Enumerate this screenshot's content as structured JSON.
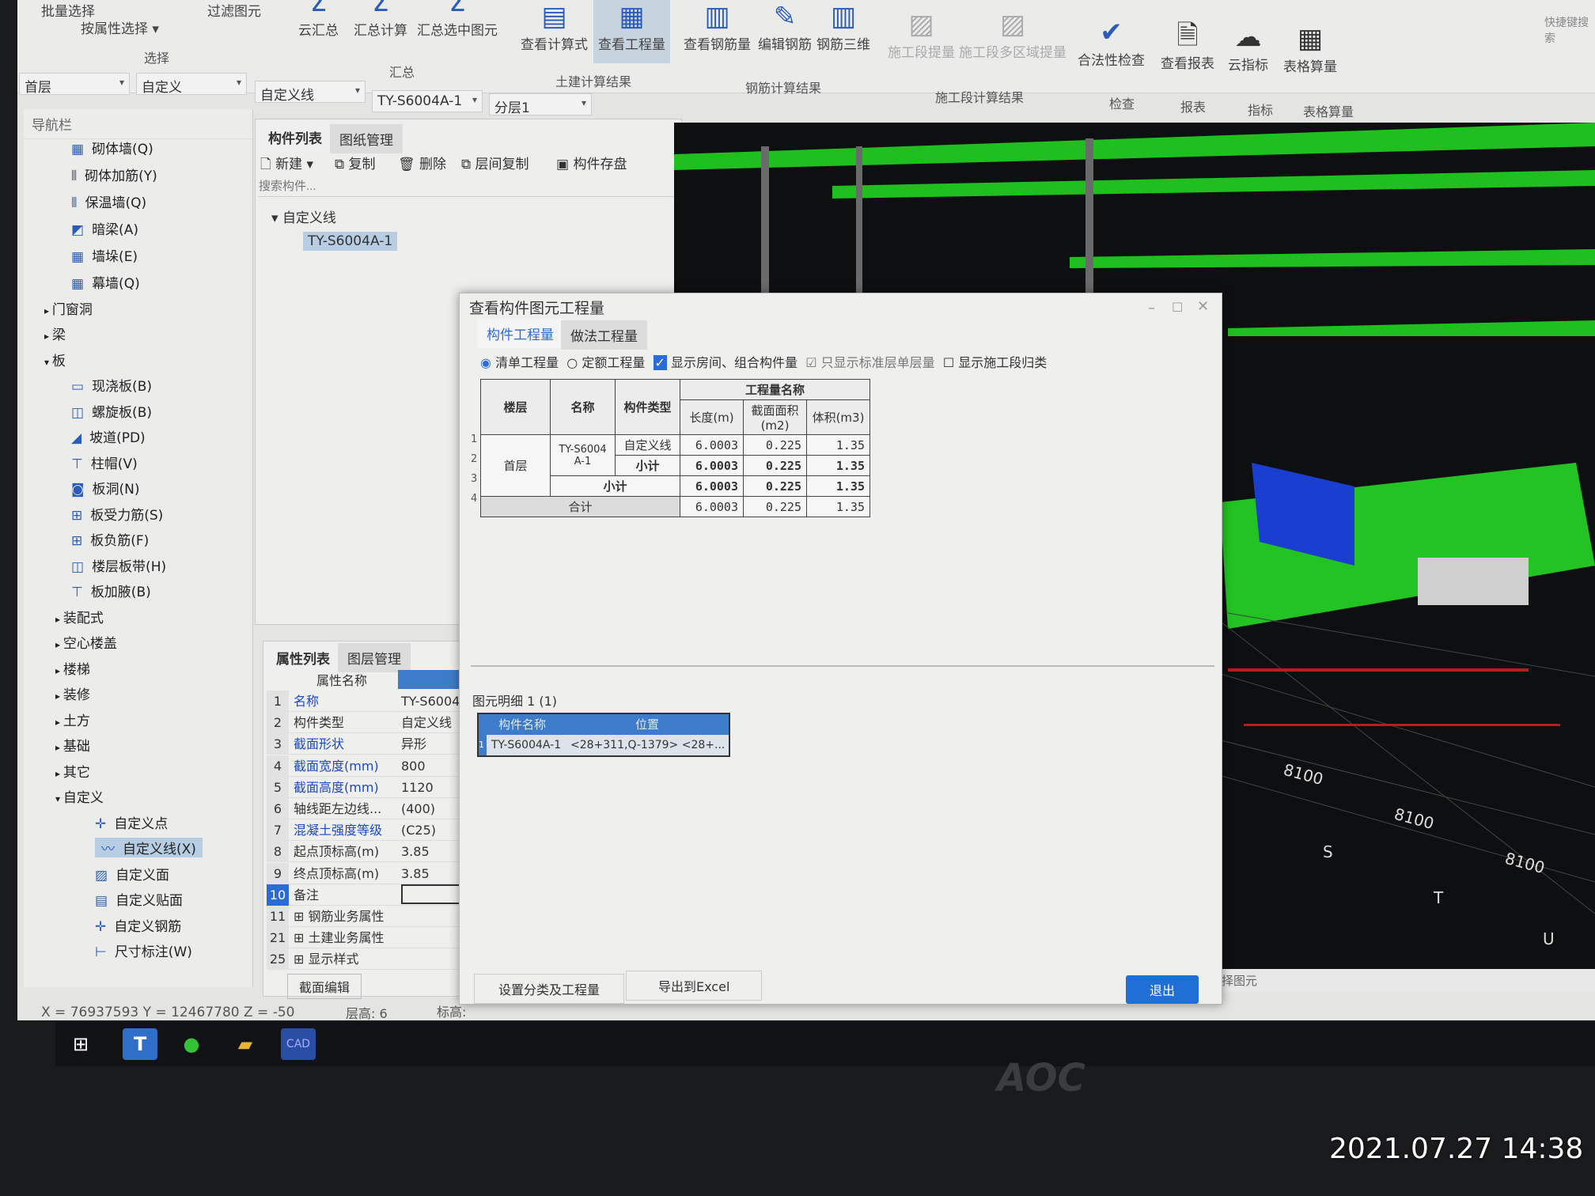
{
  "ribbon": {
    "select_group": "选择",
    "batch_select": "批量选择",
    "filter": "过滤图元",
    "by_attr": "按属性选择",
    "sum_group": "汇总",
    "cloud_sum": "云汇总",
    "sum_calc": "汇总计算",
    "sum_selected": "汇总选中图元",
    "civil_group": "土建计算结果",
    "view_formula": "查看计算式",
    "view_quantity": "查看工程量",
    "rebar_group": "钢筋计算结果",
    "view_rebar": "查看钢筋量",
    "edit_rebar": "编辑钢筋",
    "rebar_3d": "钢筋三维",
    "stage_group": "施工段计算结果",
    "stage_qty": "施工段提量",
    "stage_multi": "施工段多区域提量",
    "check_group": "检查",
    "legality": "合法性检查",
    "report_group": "报表",
    "view_report": "查看报表",
    "index_group": "指标",
    "cloud_index": "云指标",
    "table_group": "表格算量",
    "table_calc": "表格算量",
    "quick_search": "快捷键搜索"
  },
  "combos": {
    "floor": "首层",
    "category": "自定义",
    "type": "自定义线",
    "component": "TY-S6004A-1",
    "layer": "分层1"
  },
  "nav": {
    "title": "导航栏",
    "items": [
      {
        "label": "砌体墙(Q)"
      },
      {
        "label": "砌体加筋(Y)"
      },
      {
        "label": "保温墙(Q)"
      },
      {
        "label": "暗梁(A)"
      },
      {
        "label": "墙垛(E)"
      },
      {
        "label": "幕墙(Q)"
      },
      {
        "label": "门窗洞"
      },
      {
        "label": "梁"
      },
      {
        "label": "板"
      },
      {
        "label": "现浇板(B)"
      },
      {
        "label": "螺旋板(B)"
      },
      {
        "label": "坡道(PD)"
      },
      {
        "label": "柱帽(V)"
      },
      {
        "label": "板洞(N)"
      },
      {
        "label": "板受力筋(S)"
      },
      {
        "label": "板负筋(F)"
      },
      {
        "label": "楼层板带(H)"
      },
      {
        "label": "板加腋(B)"
      },
      {
        "label": "装配式"
      },
      {
        "label": "空心楼盖"
      },
      {
        "label": "楼梯"
      },
      {
        "label": "装修"
      },
      {
        "label": "土方"
      },
      {
        "label": "基础"
      },
      {
        "label": "其它"
      },
      {
        "label": "自定义"
      },
      {
        "label": "自定义点"
      },
      {
        "label": "自定义线(X)"
      },
      {
        "label": "自定义面"
      },
      {
        "label": "自定义贴面"
      },
      {
        "label": "自定义钢筋"
      },
      {
        "label": "尺寸标注(W)"
      }
    ]
  },
  "complist": {
    "tab1": "构件列表",
    "tab2": "图纸管理",
    "new": "新建",
    "copy": "复制",
    "delete": "删除",
    "floor_copy": "层间复制",
    "save": "构件存盘",
    "search_placeholder": "搜索构件...",
    "group": "自定义线",
    "item": "TY-S6004A-1"
  },
  "props": {
    "tab1": "属性列表",
    "tab2": "图层管理",
    "header": "属性名称",
    "rows": [
      {
        "n": "1",
        "k": "名称",
        "v": "TY-S6004A-1"
      },
      {
        "n": "2",
        "k": "构件类型",
        "v": "自定义线"
      },
      {
        "n": "3",
        "k": "截面形状",
        "v": "异形"
      },
      {
        "n": "4",
        "k": "截面宽度(mm)",
        "v": "800"
      },
      {
        "n": "5",
        "k": "截面高度(mm)",
        "v": "1120"
      },
      {
        "n": "6",
        "k": "轴线距左边线...",
        "v": "(400)"
      },
      {
        "n": "7",
        "k": "混凝土强度等级",
        "v": "(C25)"
      },
      {
        "n": "8",
        "k": "起点顶标高(m)",
        "v": "3.85"
      },
      {
        "n": "9",
        "k": "终点顶标高(m)",
        "v": "3.85"
      },
      {
        "n": "10",
        "k": "备注",
        "v": ""
      },
      {
        "n": "11",
        "k": "钢筋业务属性",
        "v": ""
      },
      {
        "n": "21",
        "k": "土建业务属性",
        "v": ""
      },
      {
        "n": "25",
        "k": "显示样式",
        "v": ""
      }
    ],
    "section_edit": "截面编辑"
  },
  "status": {
    "coords": "X = 76937593 Y = 12467780 Z = -50",
    "floor_height_label": "层高:",
    "floor_height": "6",
    "elev_label": "标高:",
    "right": "择图元"
  },
  "view3d": {
    "labels": [
      "8100",
      "8100",
      "8100",
      "S",
      "T",
      "U"
    ]
  },
  "dialog": {
    "title": "查看构件图元工程量",
    "tab1": "构件工程量",
    "tab2": "做法工程量",
    "opt_bill": "清单工程量",
    "opt_quota": "定额工程量",
    "chk_room": "显示房间、组合构件量",
    "chk_std": "只显示标准层单层量",
    "chk_stage": "显示施工段归类",
    "table": {
      "h_floor": "楼层",
      "h_name": "名称",
      "h_type": "构件类型",
      "h_qty": "工程量名称",
      "h_len": "长度(m)",
      "h_area": "截面面积(m2)",
      "h_vol": "体积(m3)",
      "floor": "首层",
      "name": "TY-S6004A-1",
      "type": "自定义线",
      "subtotal": "小计",
      "total": "合计",
      "rows": [
        {
          "no": "1",
          "len": "6.0003",
          "area": "0.225",
          "vol": "1.35"
        },
        {
          "no": "2",
          "len": "6.0003",
          "area": "0.225",
          "vol": "1.35"
        },
        {
          "no": "3",
          "len": "6.0003",
          "area": "0.225",
          "vol": "1.35"
        },
        {
          "no": "4",
          "len": "6.0003",
          "area": "0.225",
          "vol": "1.35"
        }
      ]
    },
    "detail_label": "图元明细",
    "detail_count": "1 (1)",
    "detail": {
      "h_name": "构件名称",
      "h_pos": "位置",
      "no": "1",
      "name": "TY-S6004A-1",
      "pos": "<28+311,Q-1379> <28+..."
    },
    "btn_settings": "设置分类及工程量",
    "btn_excel": "导出到Excel",
    "btn_exit": "退出"
  },
  "monitor": {
    "brand": "AOC"
  },
  "photo_timestamp": "2021.07.27 14:38",
  "colors": {
    "accent": "#1f6fd6",
    "header_blue": "#3d7cc9",
    "green_model": "#2ecc2e"
  }
}
